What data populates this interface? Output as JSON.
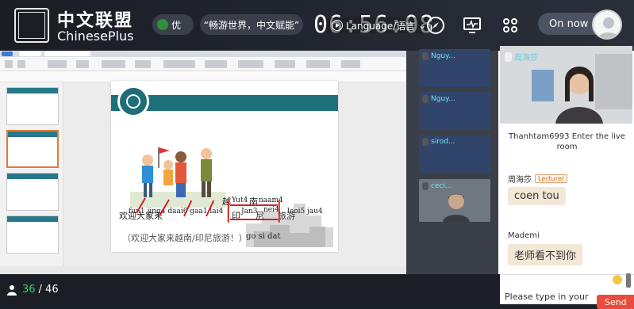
{
  "header": {
    "logo_cn": "中文联盟",
    "logo_en": "ChinesePlus",
    "quality_label": "优",
    "slogan": "“畅游世界，中文赋能”",
    "clock": "06:56:08",
    "language_label": "Language/语言",
    "status_button": "On now"
  },
  "slide": {
    "line1_pinyin": "fun1 jing4 daai6 gaa1 lai4",
    "line1_cn": "欢迎大家来",
    "yue_pinyin": "Yut4",
    "yue_cn": "越",
    "nan_pinyin": "naam4",
    "nan_cn": "南",
    "yin_pinyin": "Jan3",
    "yin_cn": "印",
    "ni_pinyin": "nei4",
    "ni_cn": "尼",
    "lvyou": "旅游",
    "lvyou_pinyin": "leoi5 jau4",
    "translation": "（欢迎大家来越南/印尼旅游！）",
    "handwritten": "go si dat"
  },
  "videos": [
    {
      "name": "Nguy..."
    },
    {
      "name": "Nguy..."
    },
    {
      "name": "sirod..."
    },
    {
      "name": "ceci..."
    }
  ],
  "teacher": {
    "name": "周海莎"
  },
  "chat": {
    "system_message": "Thanhtam6993 Enter the live room",
    "messages": [
      {
        "sender": "周海莎",
        "badge": "Lecturer",
        "text": "coen tou"
      },
      {
        "sender": "Mademi",
        "badge": "",
        "text": "老师看不到你"
      }
    ],
    "input_placeholder": "Please type in your",
    "send_label": "Send"
  },
  "footer": {
    "online": "36",
    "total": "/ 46"
  }
}
